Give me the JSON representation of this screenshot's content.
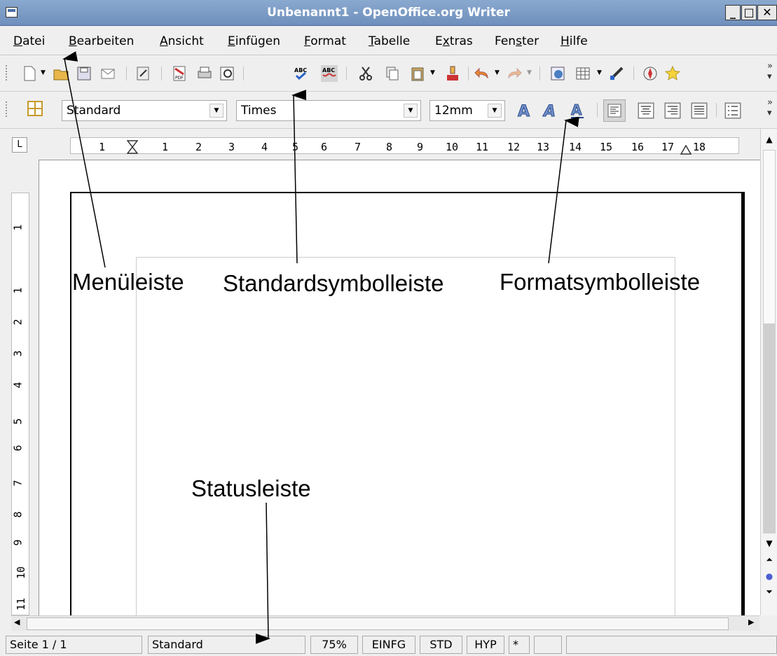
{
  "window": {
    "title": "Unbenannt1 - OpenOffice.org Writer"
  },
  "menubar": {
    "items": [
      {
        "u": "D",
        "rest": "atei"
      },
      {
        "u": "B",
        "rest": "earbeiten"
      },
      {
        "u": "A",
        "rest": "nsicht"
      },
      {
        "u": "E",
        "rest": "infügen"
      },
      {
        "u": "F",
        "rest": "ormat"
      },
      {
        "u": "T",
        "rest": "abelle"
      },
      {
        "pre": "E",
        "u": "x",
        "rest": "tras"
      },
      {
        "pre": "Fen",
        "u": "s",
        "rest": "ter"
      },
      {
        "u": "H",
        "rest": "ilfe"
      }
    ]
  },
  "format_toolbar": {
    "style": "Standard",
    "font": "Times",
    "size": "12mm"
  },
  "ruler": {
    "labels": [
      "1",
      "1",
      "2",
      "3",
      "4",
      "5",
      "6",
      "7",
      "8",
      "9",
      "10",
      "11",
      "12",
      "13",
      "14",
      "15",
      "16",
      "17",
      "18"
    ],
    "vlabels": [
      "1",
      "1",
      "2",
      "3",
      "4",
      "5",
      "6",
      "7",
      "8",
      "9",
      "10",
      "11"
    ]
  },
  "statusbar": {
    "page": "Seite 1 / 1",
    "style": "Standard",
    "zoom": "75%",
    "insert": "EINFG",
    "selection": "STD",
    "hyperlink": "HYP",
    "modified": "*"
  },
  "annotations": {
    "menu": "Menüleiste",
    "standard": "Standardsymbolleiste",
    "format": "Formatsymbolleiste",
    "status": "Statusleiste"
  }
}
